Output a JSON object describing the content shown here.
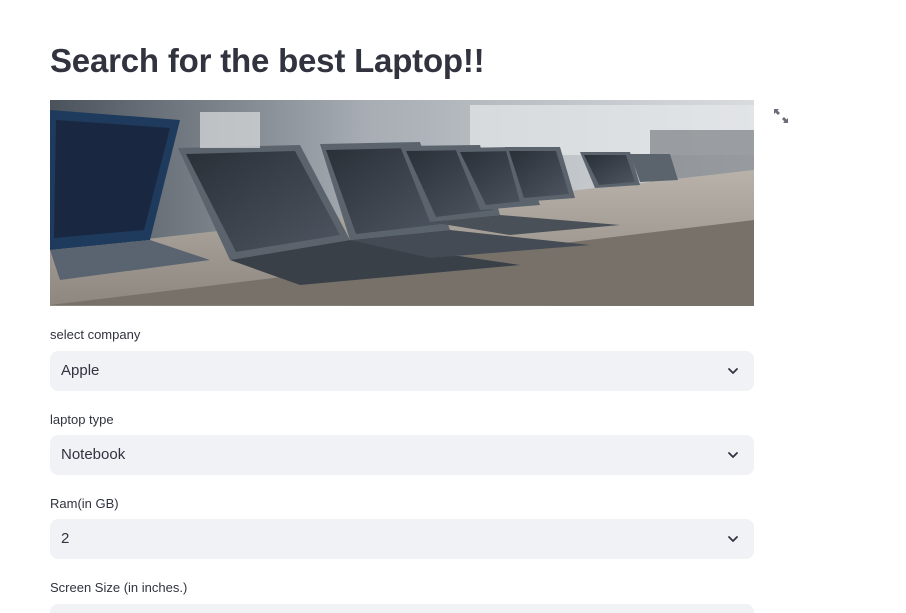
{
  "page": {
    "title": "Search for the best Laptop!!"
  },
  "hero_image": {
    "description_icon": "laptop-showroom-photo"
  },
  "icons": {
    "fullscreen": "expand-arrows-icon",
    "dropdown": "chevron-down-icon"
  },
  "form": {
    "company": {
      "label": "select company",
      "value": "Apple"
    },
    "type": {
      "label": "laptop type",
      "value": "Notebook"
    },
    "ram": {
      "label": "Ram(in GB)",
      "value": "2"
    },
    "screen": {
      "label": "Screen Size (in inches.)",
      "value": ""
    }
  },
  "colors": {
    "text": "#31333f",
    "select_bg": "#f0f2f6",
    "background": "#ffffff"
  }
}
